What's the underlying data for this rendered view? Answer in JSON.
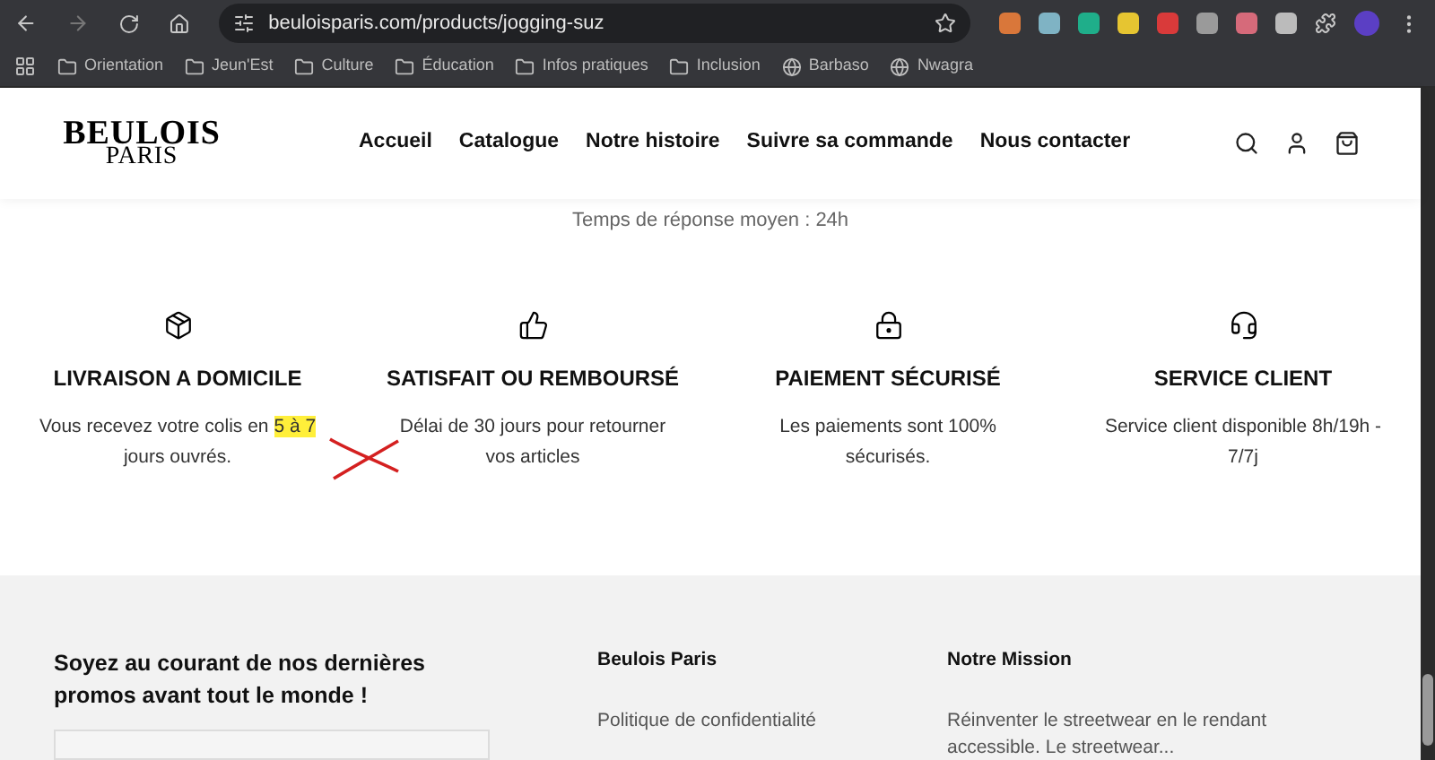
{
  "browser": {
    "url": "beuloisparis.com/products/jogging-suz",
    "bookmarks": [
      {
        "kind": "folder",
        "label": "Orientation"
      },
      {
        "kind": "folder",
        "label": "Jeun'Est"
      },
      {
        "kind": "folder",
        "label": "Culture"
      },
      {
        "kind": "folder",
        "label": "Éducation"
      },
      {
        "kind": "folder",
        "label": "Infos pratiques"
      },
      {
        "kind": "folder",
        "label": "Inclusion"
      },
      {
        "kind": "site",
        "label": "Barbaso"
      },
      {
        "kind": "site",
        "label": "Nwagra"
      }
    ],
    "extensions": [
      {
        "color": "#d9773a"
      },
      {
        "color": "#7fb3c4"
      },
      {
        "color": "#1fae8a"
      },
      {
        "color": "#e6c531"
      },
      {
        "color": "#d93a3a"
      },
      {
        "color": "#9a9a9a"
      },
      {
        "color": "#d66a7a"
      },
      {
        "color": "#bbbbbb"
      }
    ]
  },
  "header": {
    "logo_top": "BEULOIS",
    "logo_bottom": "PARIS",
    "nav": [
      "Accueil",
      "Catalogue",
      "Notre histoire",
      "Suivre sa commande",
      "Nous contacter"
    ]
  },
  "notice": "Temps de réponse moyen : 24h",
  "features": [
    {
      "kind": "box",
      "title": "LIVRAISON A DOMICILE",
      "text": "Vous recevez votre colis en",
      "highlight": "5 à 7",
      "text_end": "jours ouvrés."
    },
    {
      "kind": "thumb",
      "title": "SATISFAIT OU REMBOURSÉ",
      "text": "Délai de 30 jours pour retourner vos articles"
    },
    {
      "kind": "lock",
      "title": "PAIEMENT SÉCURISÉ",
      "text": "Les paiements sont 100% sécurisés."
    },
    {
      "kind": "support",
      "title": "SERVICE CLIENT",
      "text": "Service client disponible 8h/19h - 7/7j"
    }
  ],
  "footer": {
    "newsletter_title": "Soyez au courant de nos dernières promos avant tout le monde !",
    "columns": [
      {
        "title": "Beulois Paris",
        "links": [
          "Politique de confidentialité"
        ]
      },
      {
        "title": "Notre Mission",
        "text": "Réinventer le streetwear en le rendant accessible. Le streetwear..."
      }
    ]
  }
}
